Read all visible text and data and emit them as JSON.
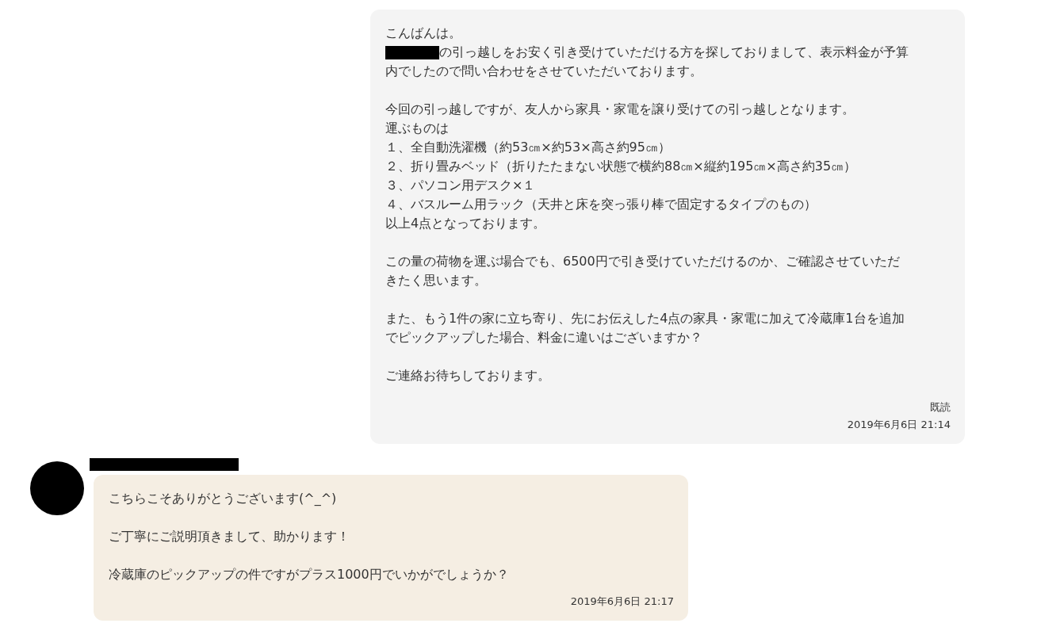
{
  "messages": [
    {
      "kind": "sent",
      "paragraphs": [
        [
          {
            "kind": "text",
            "text": "こんばんは。"
          },
          {
            "kind": "redacted",
            "text": "の引っ越しをお安く引き受けていただける方を探しておりまして、表示料金が予算"
          },
          {
            "kind": "text",
            "text": "内でしたので問い合わせをさせていただいております。"
          }
        ],
        [
          {
            "kind": "text",
            "text": "今回の引っ越しですが、友人から家具・家電を譲り受けての引っ越しとなります。"
          },
          {
            "kind": "text",
            "text": "運ぶものは"
          },
          {
            "kind": "text",
            "text": "１、全自動洗濯機（約53㎝×約53×高さ約95㎝）"
          },
          {
            "kind": "text",
            "text": "２、折り畳みベッド（折りたたまない状態で横約88㎝×縦約195㎝×高さ約35㎝）"
          },
          {
            "kind": "text",
            "text": "３、パソコン用デスク×１"
          },
          {
            "kind": "text",
            "text": "４、バスルーム用ラック（天井と床を突っ張り棒で固定するタイプのもの）"
          },
          {
            "kind": "text",
            "text": "以上4点となっております。"
          }
        ],
        [
          {
            "kind": "text",
            "text": "この量の荷物を運ぶ場合でも、6500円で引き受けていただけるのか、ご確認させていただ"
          },
          {
            "kind": "text",
            "text": "きたく思います。"
          }
        ],
        [
          {
            "kind": "text",
            "text": "また、もう1件の家に立ち寄り、先にお伝えした4点の家具・家電に加えて冷蔵庫1台を追加"
          },
          {
            "kind": "text",
            "text": "でピックアップした場合、料金に違いはございますか？"
          }
        ],
        [
          {
            "kind": "text",
            "text": "ご連絡お待ちしております。"
          }
        ]
      ],
      "read_status": "既読",
      "time": "2019年6月6日 21:14"
    },
    {
      "kind": "received",
      "paragraphs": [
        [
          {
            "kind": "text",
            "text": "こちらこそありがとうございます(^_^)"
          }
        ],
        [
          {
            "kind": "text",
            "text": "ご丁寧にご説明頂きまして、助かります！"
          }
        ],
        [
          {
            "kind": "text",
            "text": "冷蔵庫のピックアップの件ですがプラス1000円でいかがでしょうか？"
          }
        ]
      ],
      "time": "2019年6月6日 21:17"
    }
  ]
}
